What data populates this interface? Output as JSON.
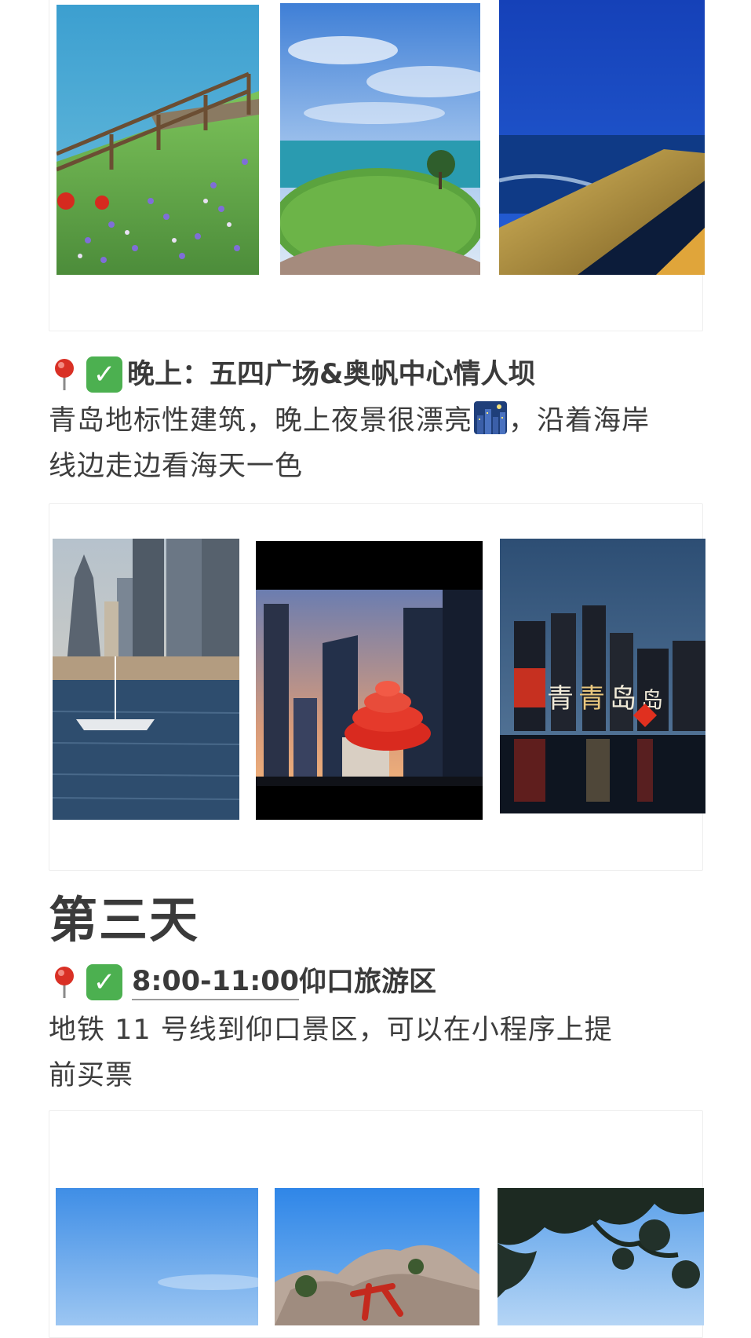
{
  "evening_section": {
    "time_label": "晚上：",
    "place": "五四广场&奥帆中心情人坝",
    "description_line1_a": "青岛地标性建筑，晚上夜景很漂亮",
    "description_line1_b": "，沿着海岸",
    "description_line2": "线边走边看海天一色"
  },
  "day3": {
    "title": "第三天"
  },
  "morning_section": {
    "time": "8:00-11:00",
    "place": "仰口旅游区",
    "description_line1": "地铁 11 号线到仰口景区，可以在小程序上提",
    "description_line2": "前买票"
  },
  "icons": {
    "pin": "round-pushpin-icon",
    "check": "white-check-mark-icon",
    "night": "night-city-icon"
  },
  "colors": {
    "check_green": "#4cb050",
    "pin_red": "#d93025",
    "text": "#3d3d3d"
  }
}
